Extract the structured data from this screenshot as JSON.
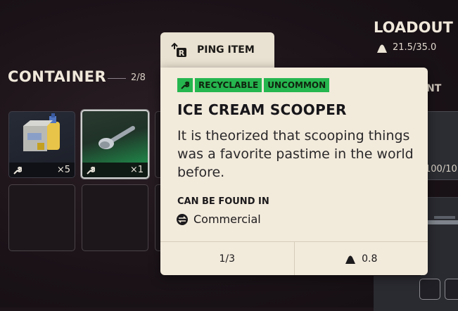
{
  "container": {
    "title": "CONTAINER",
    "count": "2/8",
    "slots": [
      {
        "quantity": "×5"
      },
      {
        "quantity": "×1"
      }
    ]
  },
  "loadout": {
    "title": "LOADOUT",
    "weight": "21.5/35.0",
    "partial_label": "NT",
    "partial_value": "100/10"
  },
  "ping": {
    "label": "PING ITEM",
    "key_glyph": "R"
  },
  "item": {
    "tags": [
      "RECYCLABLE",
      "UNCOMMON"
    ],
    "name": "ICE CREAM SCOOPER",
    "description": "It is theorized that scooping things was a favorite pastime in the world before.",
    "found_in_label": "CAN BE FOUND IN",
    "found_in_location": "Commercial",
    "stack": "1/3",
    "weight": "0.8"
  },
  "colors": {
    "rarity_green": "#26b64f",
    "card_bg": "#f2eadb",
    "background": "#1c1418"
  },
  "icons": [
    "wrench-icon",
    "weight-icon",
    "location-swap-icon",
    "ping-key-icon"
  ]
}
